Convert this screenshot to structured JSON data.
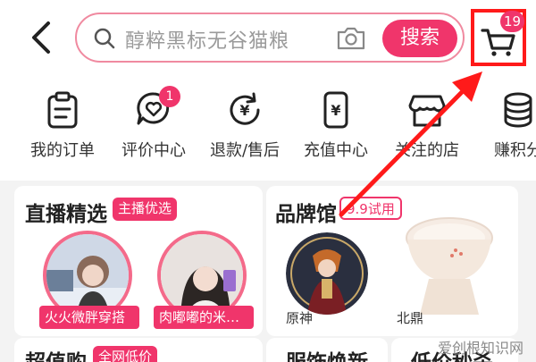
{
  "header": {
    "search_placeholder": "醇粹黑标无谷猫粮",
    "search_button": "搜索",
    "cart_badge": "19"
  },
  "shortcuts": [
    {
      "label": "我的订单",
      "icon": "clipboard-icon"
    },
    {
      "label": "评价中心",
      "icon": "review-heart-icon",
      "badge": "1"
    },
    {
      "label": "退款/售后",
      "icon": "refund-icon"
    },
    {
      "label": "充值中心",
      "icon": "phone-recharge-icon"
    },
    {
      "label": "关注的店",
      "icon": "store-icon"
    },
    {
      "label": "赚积分",
      "icon": "coins-icon"
    }
  ],
  "live": {
    "title": "直播精选",
    "tag": "主播优选",
    "hosts": [
      {
        "name": "火火微胖穿搭"
      },
      {
        "name": "肉嘟嘟的米…"
      }
    ]
  },
  "brand": {
    "title": "品牌馆",
    "tag": "9.9试用",
    "items": [
      {
        "label": "原神"
      },
      {
        "label": "北鼎"
      }
    ]
  },
  "bottom_row": {
    "left_title": "超值购",
    "left_tag": "全网低价",
    "middle_title": "服饰焕新",
    "right_title": "低价秒杀"
  },
  "watermark": "爱创根知识网",
  "colors": {
    "accent": "#f0356b",
    "highlight": "#ff1a1a"
  }
}
